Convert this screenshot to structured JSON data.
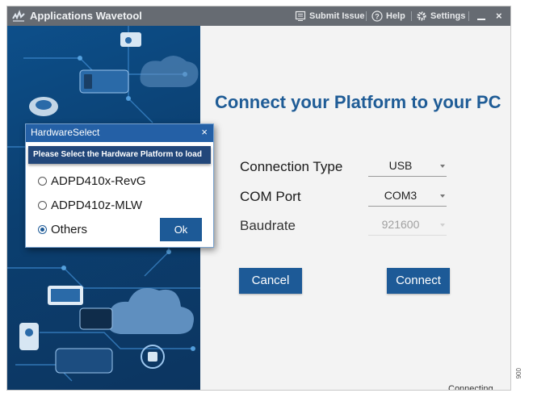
{
  "titlebar": {
    "app_title": "Applications Wavetool",
    "submit_issue_label": "Submit Issue",
    "help_label": "Help",
    "settings_label": "Settings",
    "minimize_symbol": "–",
    "close_symbol": "×",
    "icons": [
      "wavetool-logo-icon",
      "submit-issue-icon",
      "help-icon",
      "gear-icon",
      "minimize-icon",
      "close-icon"
    ]
  },
  "main": {
    "heading": "Connect your Platform to your PC",
    "connection_type": {
      "label": "Connection Type",
      "value": "USB"
    },
    "com_port": {
      "label": "COM Port",
      "value": "COM3"
    },
    "baudrate": {
      "label": "Baudrate",
      "value": "921600",
      "disabled": true
    },
    "cancel_label": "Cancel",
    "connect_label": "Connect",
    "status": "Connecting..."
  },
  "dialog": {
    "title": "HardwareSelect",
    "close_symbol": "×",
    "banner": "Please Select the Hardware Platform to load",
    "options": [
      {
        "label": "ADPD410x-RevG",
        "checked": false
      },
      {
        "label": "ADPD410z-MLW",
        "checked": false
      },
      {
        "label": "Others",
        "checked": true
      }
    ],
    "ok_label": "Ok"
  },
  "side_code": "006",
  "colors": {
    "titlebar_bg": "#666b72",
    "accent_blue": "#1d5a97",
    "heading_blue": "#1f5c96",
    "dialog_title_bg": "#2460a6",
    "banner_bg": "#22477a",
    "left_panel_bg": "#0d4f8a"
  }
}
